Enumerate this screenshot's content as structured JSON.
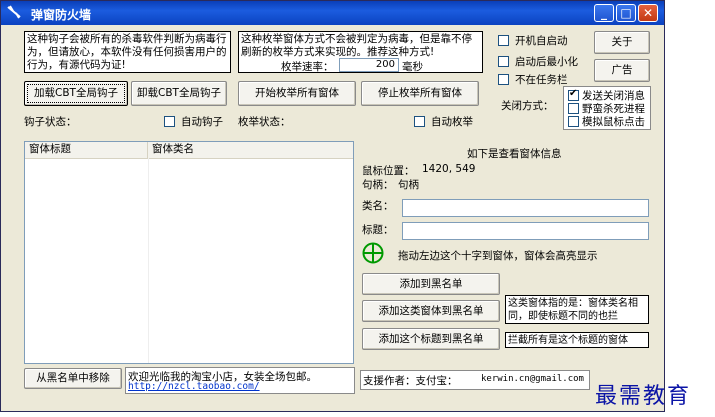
{
  "window": {
    "title": "弹窗防火墙"
  },
  "info": {
    "hook_desc": "这种钩子会被所有的杀毒软件判断为病毒行为，但请放心，本软件没有任何损害用户的行为，有源代码为证!",
    "enum_desc": "这种枚举窗体方式不会被判定为病毒，但是靠不停刷新的枚举方式来实现的。推荐这种方式!"
  },
  "enum_speed": {
    "label": "枚举速率：",
    "value": "200",
    "unit": "毫秒"
  },
  "options": {
    "autostart": {
      "label": "开机自启动",
      "checked": false
    },
    "minimize": {
      "label": "启动后最小化",
      "checked": false
    },
    "no_taskbar": {
      "label": "不在任务栏",
      "checked": false
    }
  },
  "buttons": {
    "about": "关于",
    "ads": "广告",
    "load_hook": "加载CBT全局钩子",
    "unload_hook": "卸载CBT全局钩子",
    "start_enum": "开始枚举所有窗体",
    "stop_enum": "停止枚举所有窗体",
    "add_blacklist": "添加到黑名单",
    "add_class_blacklist": "添加这类窗体到黑名单",
    "add_title_blacklist": "添加这个标题到黑名单",
    "remove_blacklist": "从黑名单中移除"
  },
  "close_method": {
    "label": "关闭方式：",
    "items": [
      {
        "label": "发送关闭消息",
        "checked": true
      },
      {
        "label": "野蛮杀死进程",
        "checked": false
      },
      {
        "label": "模拟鼠标点击",
        "checked": false
      }
    ]
  },
  "status": {
    "hook_label": "钩子状态：",
    "auto_hook": "自动钩子",
    "enum_label": "枚举状态：",
    "auto_enum": "自动枚举"
  },
  "list": {
    "columns": [
      "窗体标题",
      "窗体类名"
    ]
  },
  "window_info": {
    "heading": "如下是查看窗体信息",
    "mouse_pos_label": "鼠标位置：",
    "mouse_pos_value": "1420,  549",
    "handle_label": "句柄：",
    "handle_value": "句柄",
    "class_label": "类名：",
    "title_label": "标题：",
    "crosshair_hint": "拖动左边这个十字到窗体，窗体会高亮显示"
  },
  "notes": {
    "class_note": "这类窗体指的是：窗体类名相同，即使标题不同的也拦",
    "title_note": "拦截所有是这个标题的窗体"
  },
  "footer": {
    "welcome": "欢迎光临我的淘宝小店，女装全场包邮。",
    "shop_link": "http://nzcl.taobao.com/",
    "support": "支援作者：支付宝：",
    "email": "kerwin.cn@gmail.com",
    "com": "com"
  },
  "watermark": "最需教育",
  "colors": {
    "titlebar": "#1b5cdf",
    "face": "#ece9d8",
    "link": "#0033cc",
    "watermark": "#0b14a6"
  }
}
